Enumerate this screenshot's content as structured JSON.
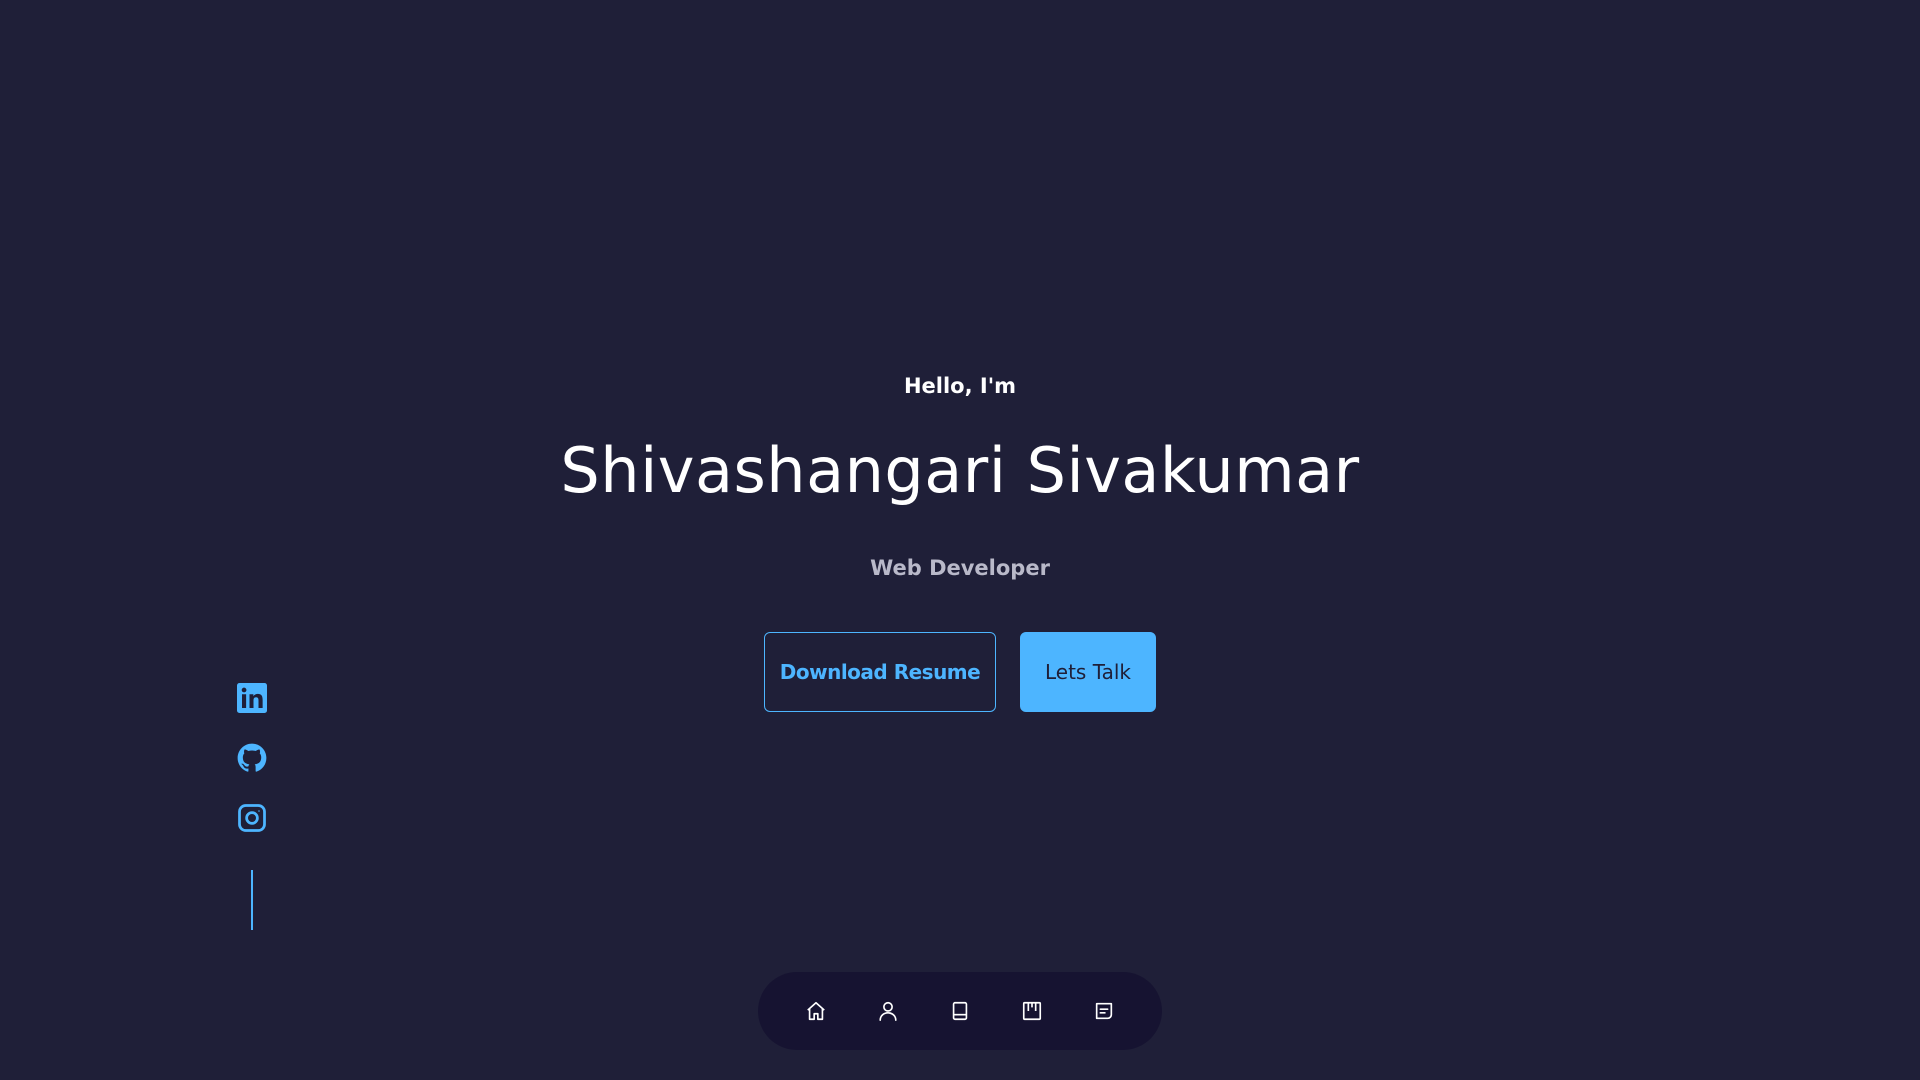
{
  "hero": {
    "greeting": "Hello, I'm",
    "name": "Shivashangari Sivakumar",
    "role": "Web Developer"
  },
  "buttons": {
    "download_label": "Download Resume",
    "talk_label": "Lets Talk"
  },
  "socials": [
    {
      "icon": "linkedin-icon"
    },
    {
      "icon": "github-icon"
    },
    {
      "icon": "instagram-icon"
    }
  ],
  "nav": [
    {
      "icon": "home-icon"
    },
    {
      "icon": "user-icon"
    },
    {
      "icon": "book-icon"
    },
    {
      "icon": "portfolio-icon"
    },
    {
      "icon": "message-icon"
    }
  ],
  "colors": {
    "background": "#1f1f38",
    "accent": "#4db5ff",
    "nav_background": "#161331",
    "text": "#ffffff",
    "muted_text": "#b9b9c9"
  }
}
